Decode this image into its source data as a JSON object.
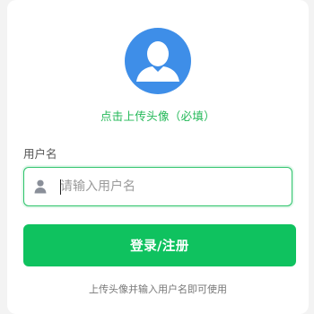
{
  "avatar": {
    "icon": "user-silhouette-icon",
    "hint": "点击上传头像（必填）"
  },
  "form": {
    "username_label": "用户名",
    "username_placeholder": "请输入用户名",
    "username_value": "",
    "username_icon": "user-icon"
  },
  "actions": {
    "submit_label": "登录/注册"
  },
  "footer": {
    "tip": "上传头像并输入用户名即可使用"
  },
  "colors": {
    "accent": "#0fc25f",
    "avatar_bg": "#3e8ee8",
    "hint_text": "#22b857"
  }
}
